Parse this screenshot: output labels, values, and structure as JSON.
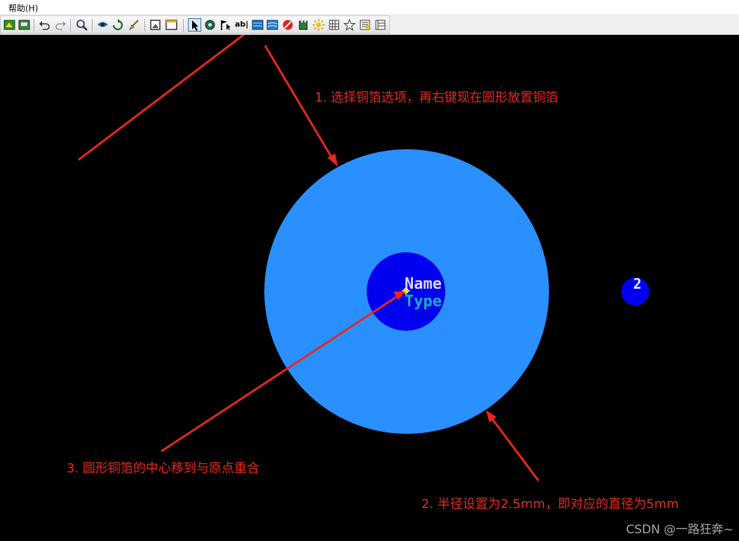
{
  "menubar": {
    "help": "帮助(H)"
  },
  "toolbar": {
    "buttons": [
      {
        "name": "layer-tool-icon"
      },
      {
        "name": "pcb-tool-icon"
      },
      {
        "name": "undo-icon"
      },
      {
        "name": "redo-icon"
      },
      {
        "name": "zoom-icon"
      },
      {
        "name": "view-icon"
      },
      {
        "name": "refresh-icon"
      },
      {
        "name": "brush-icon"
      },
      {
        "name": "snapshot-icon"
      },
      {
        "name": "window-icon"
      },
      {
        "name": "select-arrow-icon"
      },
      {
        "name": "rotate-icon"
      },
      {
        "name": "flag-icon"
      },
      {
        "name": "text-tool-icon"
      },
      {
        "name": "copper-icon"
      },
      {
        "name": "copper-cutout-icon"
      },
      {
        "name": "no-entry-icon"
      },
      {
        "name": "component-icon"
      },
      {
        "name": "sun-icon"
      },
      {
        "name": "grid-icon"
      },
      {
        "name": "star-icon"
      },
      {
        "name": "list-icon"
      },
      {
        "name": "table-icon"
      }
    ],
    "text_label": "ab|"
  },
  "canvas": {
    "pad_name": "Name",
    "pad_type": "Type",
    "pad2_label": "2",
    "colors": {
      "outer_copper": "#2a90ff",
      "inner_pad": "#0000f0",
      "annotation": "#e8281e"
    }
  },
  "annotations": {
    "step1": "1. 选择铜箔选项，再右键现在圆形放置铜箔",
    "step2": "2. 半径设置为2.5mm，即对应的直径为5mm",
    "step3": "3. 圆形铜箔的中心移到与原点重合"
  },
  "watermark": "CSDN @一路狂奔~"
}
